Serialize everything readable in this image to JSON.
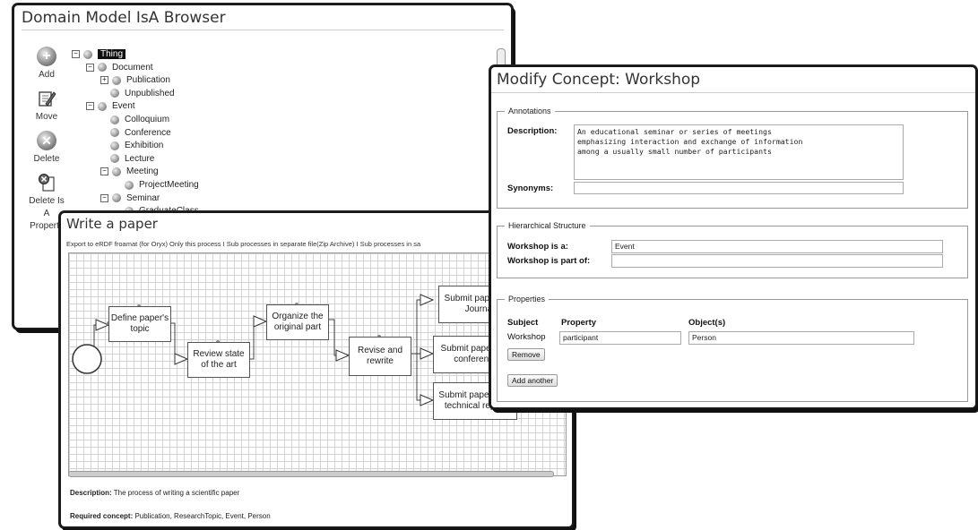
{
  "browser": {
    "title": "Domain Model IsA Browser",
    "tools": [
      {
        "label": "Add",
        "icon": "add-icon"
      },
      {
        "label": "Move",
        "icon": "move-icon"
      },
      {
        "label": "Delete",
        "icon": "delete-icon"
      },
      {
        "label": "Delete Is A Property",
        "icon": "delete-property-icon"
      }
    ],
    "tree": [
      {
        "label": "Thing",
        "level": 0,
        "toggle": "−",
        "selected": true
      },
      {
        "label": "Document",
        "level": 1,
        "toggle": "−"
      },
      {
        "label": "Publication",
        "level": 2,
        "toggle": "+"
      },
      {
        "label": "Unpublished",
        "level": 2,
        "toggle": ""
      },
      {
        "label": "Event",
        "level": 1,
        "toggle": "−"
      },
      {
        "label": "Colloquium",
        "level": 2,
        "toggle": ""
      },
      {
        "label": "Conference",
        "level": 2,
        "toggle": ""
      },
      {
        "label": "Exhibition",
        "level": 2,
        "toggle": ""
      },
      {
        "label": "Lecture",
        "level": 2,
        "toggle": ""
      },
      {
        "label": "Meeting",
        "level": 2,
        "toggle": "−"
      },
      {
        "label": "ProjectMeeting",
        "level": 3,
        "toggle": ""
      },
      {
        "label": "Seminar",
        "level": 2,
        "toggle": "−"
      },
      {
        "label": "GraduateClass",
        "level": 3,
        "toggle": ""
      }
    ]
  },
  "process": {
    "title": "Write a paper",
    "export_bar": "Export to eRDF froamat (for Oryx) Only this process I Sub processes in separate file(Zip Archive) I Sub processes in sa",
    "tasks": [
      {
        "label": "Define paper's topic"
      },
      {
        "label": "Review state of the art"
      },
      {
        "label": "Organize the original part"
      },
      {
        "label": "Revise and rewrite"
      },
      {
        "label": "Submit paper to a Journal"
      },
      {
        "label": "Submit paper to a conference"
      },
      {
        "label": "Submit paper as a technical report"
      }
    ],
    "description_label": "Description:",
    "description_value": "The process of writing a scientific paper",
    "required_label": "Required concept:",
    "required_value": "Publication, ResearchTopic, Event, Person"
  },
  "concept": {
    "title": "Modify Concept: Workshop",
    "annotations_legend": "Annotations",
    "description_label": "Description:",
    "description_value": "An educational seminar or series of meetings\nemphasizing interaction and exchange of information\namong a usually small number of participants",
    "synonyms_label": "Synonyms:",
    "synonyms_value": "",
    "hierarchy_legend": "Hierarchical Structure",
    "isa_label": "Workshop is a:",
    "isa_value": "Event",
    "partof_label": "Workshop is part of:",
    "partof_value": "",
    "properties_legend": "Properties",
    "col_subject": "Subject",
    "col_property": "Property",
    "col_objects": "Object(s)",
    "row_subject": "Workshop",
    "row_property": "participant",
    "row_object": "Person",
    "remove_button": "Remove",
    "add_button": "Add another"
  }
}
